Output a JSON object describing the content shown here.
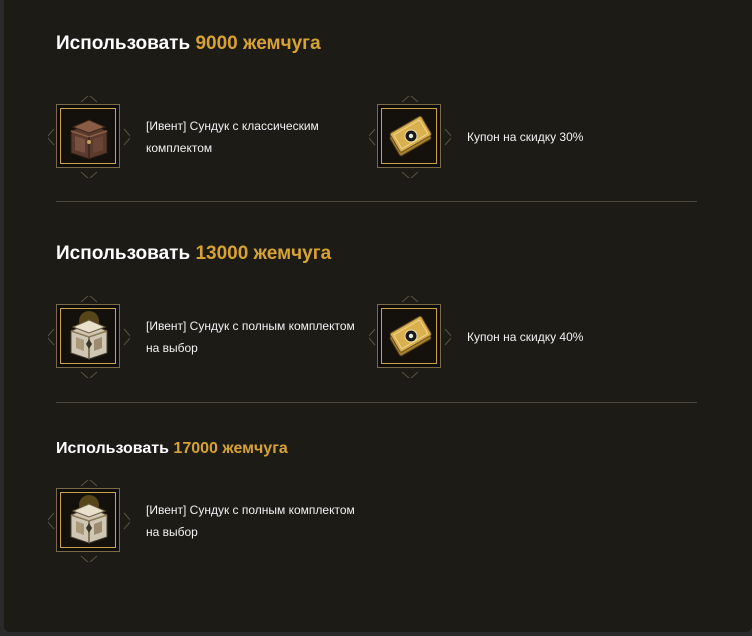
{
  "sections": [
    {
      "title_prefix": "Использовать",
      "amount": "9000 жемчуга",
      "items": [
        {
          "label": "[Ивент] Сундук с классическим комплектом",
          "icon": "bronze-chest-icon"
        },
        {
          "label": "Купон на скидку 30%",
          "icon": "gold-coupon-icon"
        }
      ]
    },
    {
      "title_prefix": "Использовать",
      "amount": "13000 жемчуга",
      "items": [
        {
          "label": "[Ивент] Сундук с полным комплектом на выбор",
          "icon": "silver-chest-icon"
        },
        {
          "label": "Купон на скидку 40%",
          "icon": "gold-coupon-icon"
        }
      ]
    },
    {
      "title_prefix": "Использовать",
      "amount": "17000 жемчуга",
      "items": [
        {
          "label": "[Ивент] Сундук с полным комплектом на выбор",
          "icon": "silver-chest-icon"
        }
      ]
    }
  ],
  "colors": {
    "background": "#1c1b16",
    "accent_gold": "#d8a232",
    "text": "#ffffff",
    "divider": "#4a473c"
  }
}
